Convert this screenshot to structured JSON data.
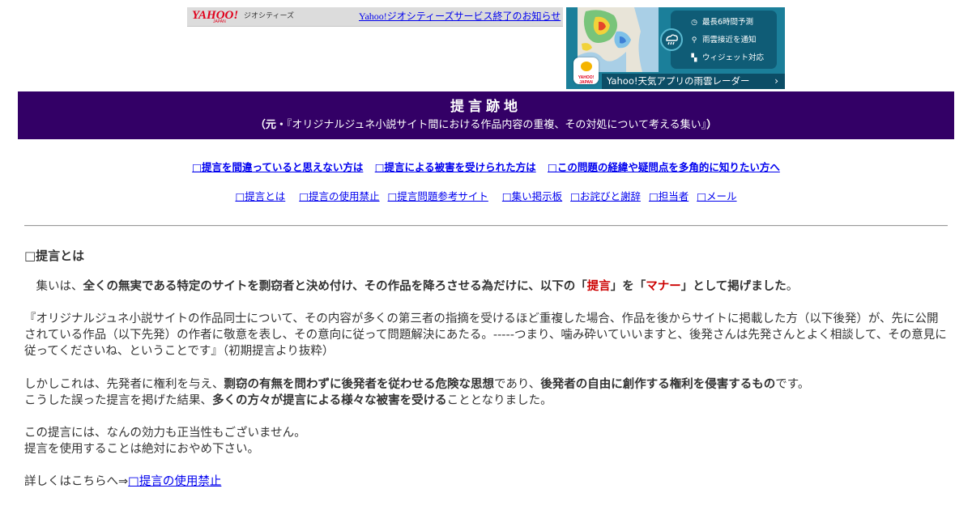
{
  "geo_bar": {
    "logo": "YAHOO!",
    "logo_sub": "JAPAN",
    "label": "ジオシティーズ",
    "notice_link": "Yahoo!ジオシティーズサービス終了のお知らせ"
  },
  "ad": {
    "features": [
      "最長6時間予測",
      "雨雲接近を通知",
      "ウィジェット対応"
    ],
    "feature_icons": [
      "clock-icon",
      "location-pin-icon",
      "widget-icon"
    ],
    "app_icon_label": "YAHOO! JAPAN",
    "cta": "Yahoo!天気アプリの雨雲レーダー",
    "colors": {
      "background": "#1b7f9a",
      "panel": "#0f5c76"
    }
  },
  "banner": {
    "title": "提言跡地",
    "subtitle_open": "（元・",
    "subtitle_body": "『オリジナルジュネ小説サイト間における作品内容の重複、その対処について考える集い』",
    "subtitle_close": "）",
    "color": "#330066"
  },
  "nav_primary": [
    "□提言を間違っていると思えない方は",
    "□提言による被害を受けられた方は",
    "□この問題の経緯や疑問点を多角的に知りたい方へ"
  ],
  "nav_secondary": [
    "□提言とは",
    "□提言の使用禁止",
    "□提言問題参考サイト",
    "□集い掲示板",
    "□お詫びと謝辞",
    "□担当者",
    "□メール"
  ],
  "content": {
    "heading": "□提言とは",
    "p1": {
      "lead": "　集いは、",
      "bold1": "全くの無実である特定のサイトを剽窃者と決め付け、その作品を降ろさせる為だけに、以下の「",
      "red1": "提言",
      "bold2": "」を「",
      "red2": "マナー",
      "bold3": "」として掲げました",
      "tail": "。"
    },
    "p2": "『オリジナルジュネ小説サイトの作品同士について、その内容が多くの第三者の指摘を受けるほど重複した場合、作品を後からサイトに掲載した方（以下後発）が、先に公開されている作品（以下先発）の作者に敬意を表し、その意向に従って問題解決にあたる。-----つまり、噛み砕いていいますと、後発さんは先発さんとよく相談して、その意見に従ってくださいね、ということです』（初期提言より抜粋）",
    "p3": {
      "a": "しかしこれは、先発者に権利を与え、",
      "b": "剽窃の有無を問わずに後発者を従わせる危険な思想",
      "c": "であり、",
      "d": "後発者の自由に創作する権利を侵害するもの",
      "e": "です。",
      "f": "こうした誤った提言を掲げた結果、",
      "g": "多くの方々が提言による様々な被害を受ける",
      "h": "こととなりました。"
    },
    "p4": {
      "line1": "この提言には、なんの効力も正当性もございません。",
      "line2": "提言を使用することは絶対におやめ下さい。"
    },
    "p5": {
      "text": "詳しくはこちらへ⇒",
      "link": "□提言の使用禁止"
    }
  }
}
